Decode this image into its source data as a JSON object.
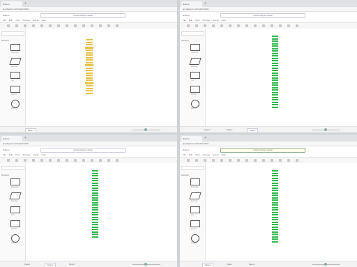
{
  "app_name": "draw.io",
  "colors": {
    "yellow": "#e8c24a",
    "green": "#31b84c"
  },
  "panes": [
    {
      "tab_label": "draw.io",
      "url": "app.diagrams.net/?splash=0#G1",
      "doc_title": "Untitled Diagram.drawio",
      "menus": [
        "File",
        "Edit",
        "View",
        "Arrange",
        "Extras",
        "Help"
      ],
      "sidebar_label": "General",
      "shape_labels": [
        "Rectangle",
        "Rounded",
        "Text",
        "Textbox",
        "Ellipse"
      ],
      "page_tabs": [
        "Page-1"
      ],
      "active_page": 0,
      "diagram": {
        "color": "#e8c24a",
        "style": "yellow",
        "count": 22
      }
    },
    {
      "tab_label": "draw.io",
      "url": "app.diagrams.net/?splash=0#G1",
      "doc_title": "Untitled Diagram.drawio",
      "menus": [
        "File",
        "Edit",
        "View",
        "Arrange",
        "Extras",
        "Help"
      ],
      "sidebar_label": "General",
      "shape_labels": [
        "Rectangle",
        "Rounded",
        "Text",
        "Textbox",
        "Ellipse"
      ],
      "page_tabs": [
        "Page-1",
        "Page-2",
        "Page-3"
      ],
      "active_page": 2,
      "diagram": {
        "color": "#31b84c",
        "style": "green",
        "count": 30
      }
    },
    {
      "tab_label": "draw.io",
      "url": "app.diagrams.net/?splash=0#G1",
      "doc_title": "Untitled Diagram.drawio",
      "menus": [
        "File",
        "Edit",
        "View",
        "Arrange",
        "Extras",
        "Help"
      ],
      "sidebar_label": "General",
      "shape_labels": [
        "Rectangle",
        "Rounded",
        "Text",
        "Textbox",
        "Ellipse"
      ],
      "page_tabs": [
        "Page-1",
        "Page-2",
        "Page-3"
      ],
      "active_page": 1,
      "diagram": {
        "color": "#31b84c",
        "style": "green",
        "count": 28
      }
    },
    {
      "tab_label": "draw.io",
      "url": "app.diagrams.net/?splash=0#G1",
      "doc_title": "Untitled Diagram.drawio",
      "menus": [
        "File",
        "Edit",
        "View",
        "Arrange",
        "Extras",
        "Help"
      ],
      "sidebar_label": "General",
      "shape_labels": [
        "Rectangle",
        "Rounded",
        "Text",
        "Textbox",
        "Ellipse"
      ],
      "page_tabs": [
        "Page-1",
        "Page-2",
        "Page-3"
      ],
      "active_page": 0,
      "diagram": {
        "color": "#31b84c",
        "style": "green",
        "count": 30
      }
    }
  ]
}
